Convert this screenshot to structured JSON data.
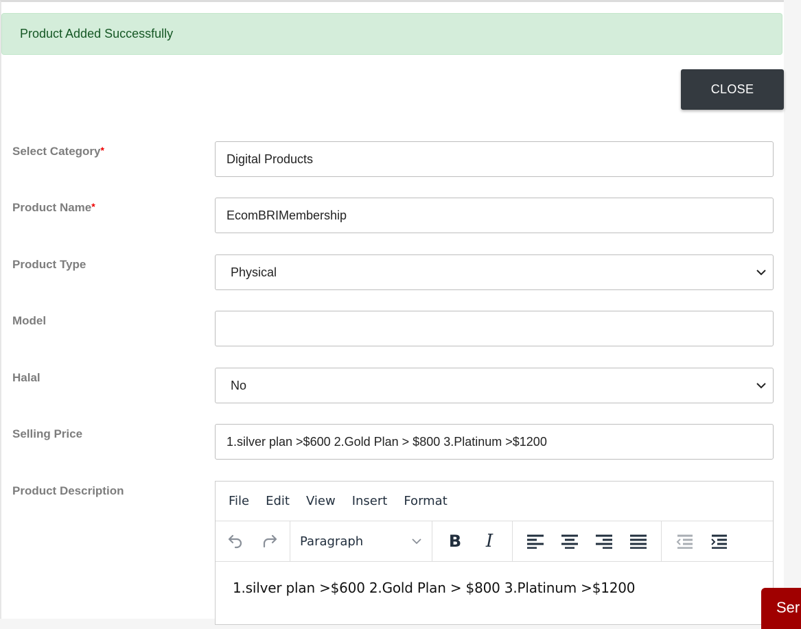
{
  "alert": {
    "message": "Product Added Successfully",
    "colors": {
      "bg": "#d4edda",
      "text": "#155724"
    }
  },
  "close_button": {
    "label": "CLOSE"
  },
  "form": {
    "category": {
      "label": "Select Category",
      "required_mark": "*",
      "value": "Digital Products"
    },
    "product_name": {
      "label": "Product Name",
      "required_mark": "*",
      "value": "EcomBRIMembership"
    },
    "product_type": {
      "label": "Product Type",
      "value": "Physical"
    },
    "model": {
      "label": "Model",
      "value": ""
    },
    "halal": {
      "label": "Halal",
      "value": "No"
    },
    "selling_price": {
      "label": "Selling Price",
      "value": "1.silver plan >$600 2.Gold Plan > $800 3.Platinum >$1200"
    },
    "description": {
      "label": "Product Description",
      "menu": [
        "File",
        "Edit",
        "View",
        "Insert",
        "Format"
      ],
      "block_format": "Paragraph",
      "content": "1.silver plan >$600 2.Gold Plan > $800 3.Platinum >$1200"
    }
  },
  "send_button": {
    "label": "Ser"
  }
}
